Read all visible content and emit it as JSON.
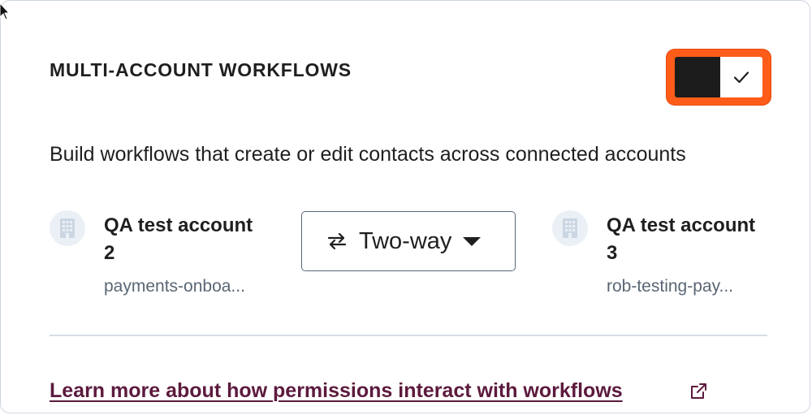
{
  "section": {
    "title": "MULTI-ACCOUNT WORKFLOWS",
    "description": "Build workflows that create or edit contacts across connected accounts"
  },
  "toggle": {
    "state": "on",
    "icon": "checkmark-icon",
    "highlight_color": "#ff5c1a"
  },
  "accounts": [
    {
      "name": "QA test account 2",
      "domain": "payments-onboa...",
      "icon": "building-icon"
    },
    {
      "name": "QA test account 3",
      "domain": "rob-testing-pay...",
      "icon": "building-icon"
    }
  ],
  "sync_direction": {
    "selected": "Two-way",
    "icon": "swap-arrows-icon"
  },
  "learn_more": {
    "label": "Learn more about how permissions interact with workflows",
    "icon": "external-link-icon",
    "color": "#5c1a3d"
  }
}
